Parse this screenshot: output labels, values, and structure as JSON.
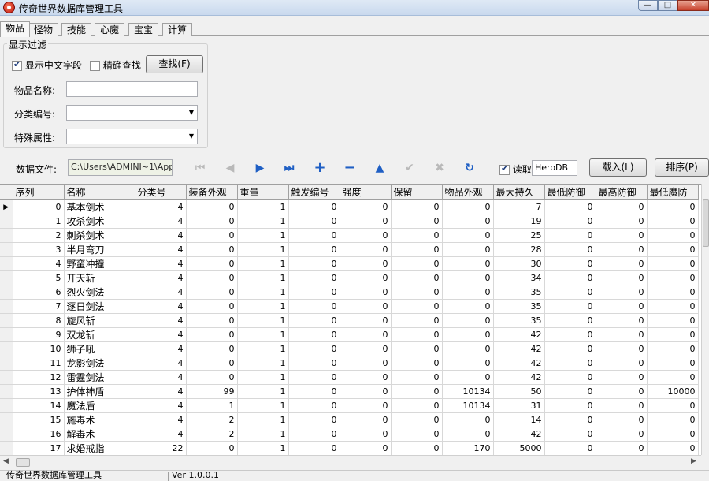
{
  "window": {
    "title": "传奇世界数据库管理工具",
    "min": "—",
    "max": "□",
    "close": "✕"
  },
  "tabs": [
    {
      "label": "物品"
    },
    {
      "label": "怪物"
    },
    {
      "label": "技能"
    },
    {
      "label": "心魔"
    },
    {
      "label": "宝宝"
    },
    {
      "label": "计算"
    }
  ],
  "filter": {
    "group_title": "显示过滤",
    "show_chinese_label": "显示中文字段",
    "show_chinese_checked": true,
    "exact_label": "精确查找",
    "exact_checked": false,
    "search_button": "查找(F)",
    "item_name_label": "物品名称:",
    "item_name_value": "",
    "category_label": "分类编号:",
    "category_value": "",
    "special_label": "特殊属性:",
    "special_value": ""
  },
  "toolbar": {
    "datafile_label": "数据文件:",
    "datafile_value": "C:\\Users\\ADMINI~1\\AppD",
    "read_label": "读取",
    "read_checked": true,
    "db_value": "HeroDB",
    "load_button": "载入(L)",
    "sort_button": "排序(P)",
    "icons": [
      "first-disabled-icon",
      "prior-disabled-icon",
      "next-icon",
      "last-icon",
      "insert-icon",
      "delete-icon",
      "edit-icon",
      "post-disabled-icon",
      "cancel-disabled-icon",
      "refresh-icon"
    ]
  },
  "grid": {
    "columns": [
      "序列",
      "名称",
      "分类号",
      "装备外观",
      "重量",
      "触发编号",
      "强度",
      "保留",
      "物品外观",
      "最大持久",
      "最低防御",
      "最高防御",
      "最低魔防"
    ],
    "rows": [
      [
        "0",
        "基本剑术",
        "4",
        "0",
        "1",
        "0",
        "0",
        "0",
        "0",
        "7",
        "0",
        "0",
        "0"
      ],
      [
        "1",
        "攻杀剑术",
        "4",
        "0",
        "1",
        "0",
        "0",
        "0",
        "0",
        "19",
        "0",
        "0",
        "0"
      ],
      [
        "2",
        "刺杀剑术",
        "4",
        "0",
        "1",
        "0",
        "0",
        "0",
        "0",
        "25",
        "0",
        "0",
        "0"
      ],
      [
        "3",
        "半月弯刀",
        "4",
        "0",
        "1",
        "0",
        "0",
        "0",
        "0",
        "28",
        "0",
        "0",
        "0"
      ],
      [
        "4",
        "野蛮冲撞",
        "4",
        "0",
        "1",
        "0",
        "0",
        "0",
        "0",
        "30",
        "0",
        "0",
        "0"
      ],
      [
        "5",
        "开天斩",
        "4",
        "0",
        "1",
        "0",
        "0",
        "0",
        "0",
        "34",
        "0",
        "0",
        "0"
      ],
      [
        "6",
        "烈火剑法",
        "4",
        "0",
        "1",
        "0",
        "0",
        "0",
        "0",
        "35",
        "0",
        "0",
        "0"
      ],
      [
        "7",
        "逐日剑法",
        "4",
        "0",
        "1",
        "0",
        "0",
        "0",
        "0",
        "35",
        "0",
        "0",
        "0"
      ],
      [
        "8",
        "旋风斩",
        "4",
        "0",
        "1",
        "0",
        "0",
        "0",
        "0",
        "35",
        "0",
        "0",
        "0"
      ],
      [
        "9",
        "双龙斩",
        "4",
        "0",
        "1",
        "0",
        "0",
        "0",
        "0",
        "42",
        "0",
        "0",
        "0"
      ],
      [
        "10",
        "狮子吼",
        "4",
        "0",
        "1",
        "0",
        "0",
        "0",
        "0",
        "42",
        "0",
        "0",
        "0"
      ],
      [
        "11",
        "龙影剑法",
        "4",
        "0",
        "1",
        "0",
        "0",
        "0",
        "0",
        "42",
        "0",
        "0",
        "0"
      ],
      [
        "12",
        "雷霆剑法",
        "4",
        "0",
        "1",
        "0",
        "0",
        "0",
        "0",
        "42",
        "0",
        "0",
        "0"
      ],
      [
        "13",
        "护体神盾",
        "4",
        "99",
        "1",
        "0",
        "0",
        "0",
        "10134",
        "50",
        "0",
        "0",
        "10000"
      ],
      [
        "14",
        "魔法盾",
        "4",
        "1",
        "1",
        "0",
        "0",
        "0",
        "10134",
        "31",
        "0",
        "0",
        "0"
      ],
      [
        "15",
        "施毒术",
        "4",
        "2",
        "1",
        "0",
        "0",
        "0",
        "0",
        "14",
        "0",
        "0",
        "0"
      ],
      [
        "16",
        "解毒术",
        "4",
        "2",
        "1",
        "0",
        "0",
        "0",
        "0",
        "42",
        "0",
        "0",
        "0"
      ],
      [
        "17",
        "求婚戒指",
        "22",
        "0",
        "1",
        "0",
        "0",
        "0",
        "170",
        "5000",
        "0",
        "0",
        "0"
      ]
    ]
  },
  "statusbar": {
    "app": "传奇世界数据库管理工具",
    "version": "Ver 1.0.0.1"
  }
}
